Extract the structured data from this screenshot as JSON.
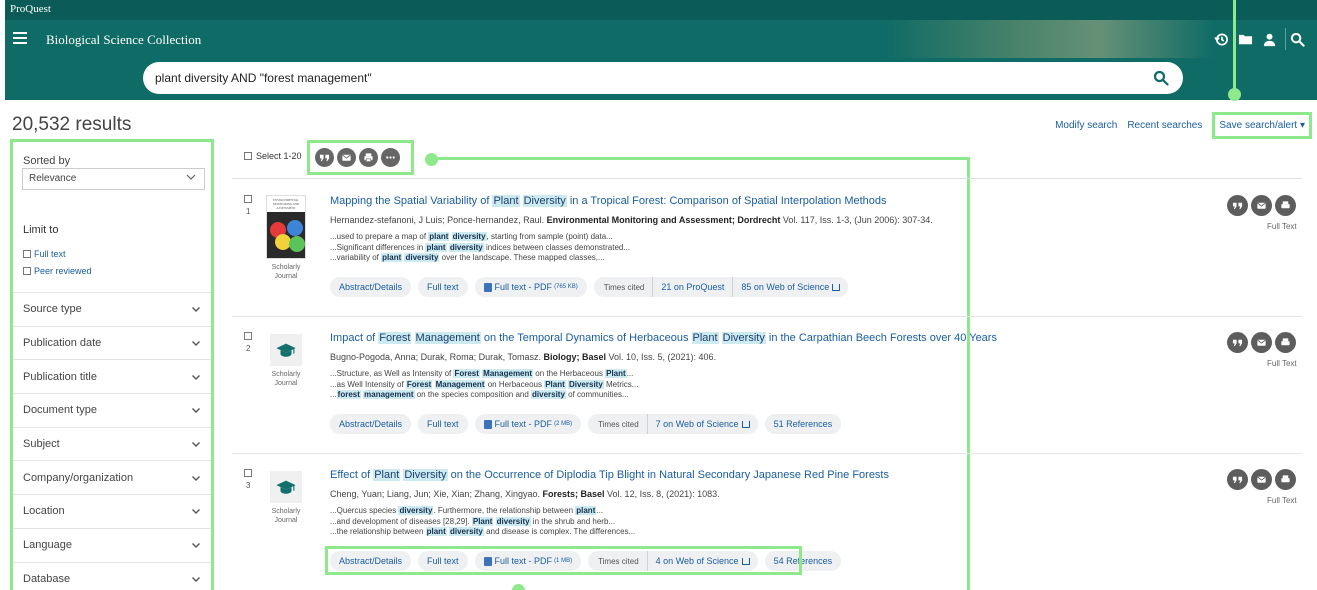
{
  "header": {
    "brand": "ProQuest",
    "collection": "Biological Science Collection",
    "icons": [
      "history-icon",
      "folder-icon",
      "user-icon",
      "search-icon"
    ]
  },
  "search": {
    "query": "plant diversity AND \"forest management\"",
    "placeholder": ""
  },
  "results_summary": {
    "count": "20,532 results",
    "modify": "Modify search",
    "recent": "Recent searches",
    "save_alert": "Save search/alert ▾"
  },
  "sidebar": {
    "sorted_by": "Sorted by",
    "sort_value": "Relevance",
    "limit_to": "Limit to",
    "limits": [
      "Full text",
      "Peer reviewed"
    ],
    "facets": [
      "Source type",
      "Publication date",
      "Publication title",
      "Document type",
      "Subject",
      "Company/organization",
      "Location",
      "Language",
      "Database"
    ]
  },
  "toolbar": {
    "select_range": "Select 1-20",
    "tools": [
      "cite-icon",
      "email-icon",
      "print-icon",
      "more-icon"
    ]
  },
  "results": [
    {
      "num": "1",
      "thumb_type": "journal-cover",
      "cover_text": "ENVIRONMENTAL MONITORING AND ASSESSMENT",
      "caption_1": "Scholarly",
      "caption_2": "Journal",
      "title_pre": "Mapping the Spatial Variability of ",
      "title_hl_1": "Plant",
      "title_hl_2": "Diversity",
      "title_post": " in a Tropical Forest: Comparison of Spatial Interpolation Methods",
      "authors": "Hernandez-stefanoni, J Luis; Ponce-hernandez, Raul.",
      "source": "Environmental Monitoring and Assessment; Dordrecht",
      "details": "Vol. 117, Iss. 1-3,  (Jun 2006): 307-34.",
      "snippets": [
        "...used to prepare a map of plant diversity, starting from sample (point) data...",
        "...Significant differences in plant diversity indices between classes demonstrated...",
        "...variability of plant diversity over the landscape. These mapped classes,..."
      ],
      "pills": [
        "Abstract/Details",
        "Full text"
      ],
      "pdf": "Full text - PDF",
      "pdf_size": "(765 KB)",
      "times_cited": "Times cited",
      "cited_links": [
        "21 on ProQuest",
        "85 on Web of Science"
      ],
      "fulltext_label": "Full Text"
    },
    {
      "num": "2",
      "thumb_type": "scholarly",
      "caption_1": "Scholarly",
      "caption_2": "Journal",
      "title_pre": "Impact of ",
      "title_hl_1": "Forest",
      "title_hl_2": "Management",
      "title_mid": " on the Temporal Dynamics of Herbaceous ",
      "title_hl_3": "Plant",
      "title_hl_4": "Diversity",
      "title_post": " in the Carpathian Beech Forests over 40 Years",
      "authors": "Bugno-Pogoda, Anna; Durak, Roma; Durak, Tomasz.",
      "source": "Biology; Basel",
      "details": "Vol. 10, Iss. 5,  (2021): 406.",
      "snippets": [
        "...Structure, as Well as Intensity of Forest Management on the Herbaceous Plant...",
        "...as Well Intensity of Forest Management on Herbaceous Plant Diversity Metrics...",
        "...forest management on the species composition and diversity of communities..."
      ],
      "pills": [
        "Abstract/Details",
        "Full text"
      ],
      "pdf": "Full text - PDF",
      "pdf_size": "(2 MB)",
      "times_cited": "Times cited",
      "cited_links": [
        "7 on Web of Science"
      ],
      "references": "51 References",
      "fulltext_label": "Full Text"
    },
    {
      "num": "3",
      "thumb_type": "scholarly",
      "caption_1": "Scholarly",
      "caption_2": "Journal",
      "title_pre": "Effect of ",
      "title_hl_1": "Plant",
      "title_hl_2": "Diversity",
      "title_post": " on the Occurrence of Diplodia Tip Blight in Natural Secondary Japanese Red Pine Forests",
      "authors": "Cheng, Yuan; Liang, Jun; Xie, Xian; Zhang, Xingyao.",
      "source": "Forests; Basel",
      "details": "Vol. 12, Iss. 8,  (2021): 1083.",
      "snippets": [
        "...Quercus species diversity. Furthermore, the relationship between plant...",
        "...and development of diseases [28,29]. Plant diversity in the shrub and herb...",
        "...the relationship between plant diversity and disease is complex. The differences..."
      ],
      "pills": [
        "Abstract/Details",
        "Full text"
      ],
      "pdf": "Full text - PDF",
      "pdf_size": "(1 MB)",
      "times_cited": "Times cited",
      "cited_links": [
        "4 on Web of Science"
      ],
      "references": "54 References",
      "fulltext_label": "Full Text"
    }
  ],
  "colors": {
    "header": "#0f6b66",
    "annotation": "#8ee88c",
    "link": "#1a5ea0",
    "highlight": "#cdeaf0"
  }
}
